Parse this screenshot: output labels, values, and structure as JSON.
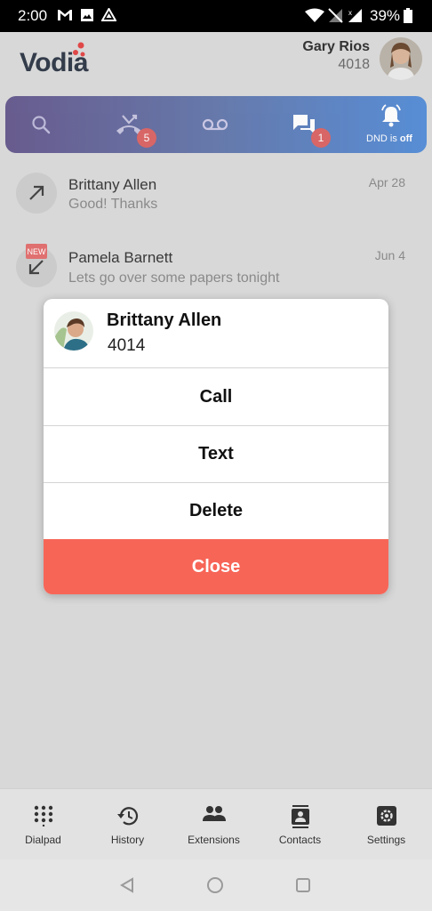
{
  "status_bar": {
    "time": "2:00",
    "battery": "39%",
    "icons": [
      "gmail-icon",
      "image-icon",
      "drive-icon",
      "wifi-icon",
      "signal-off-icon",
      "signal-icon",
      "battery-icon"
    ]
  },
  "header": {
    "logo": "Vodia",
    "user_name": "Gary Rios",
    "user_ext": "4018"
  },
  "top_nav": {
    "items": [
      {
        "name": "search",
        "icon": "search-icon"
      },
      {
        "name": "missed-calls",
        "icon": "missed-call-icon",
        "badge": "5"
      },
      {
        "name": "voicemail",
        "icon": "voicemail-icon"
      },
      {
        "name": "messages",
        "icon": "chat-icon",
        "badge": "1"
      },
      {
        "name": "dnd",
        "icon": "bell-icon",
        "label_prefix": "DND is ",
        "label_state": "off"
      }
    ]
  },
  "list": [
    {
      "name": "Brittany Allen",
      "message": "Good! Thanks",
      "date": "Apr 28",
      "direction": "outgoing"
    },
    {
      "name": "Pamela Barnett",
      "message": "Lets go over some papers tonight",
      "date": "Jun 4",
      "direction": "incoming",
      "tag": "NEW"
    }
  ],
  "dialog": {
    "name": "Brittany Allen",
    "ext": "4014",
    "buttons": {
      "call": "Call",
      "text": "Text",
      "delete": "Delete",
      "close": "Close"
    }
  },
  "bottom_nav": [
    {
      "label": "Dialpad",
      "icon": "dialpad-icon"
    },
    {
      "label": "History",
      "icon": "history-icon"
    },
    {
      "label": "Extensions",
      "icon": "extensions-icon"
    },
    {
      "label": "Contacts",
      "icon": "contacts-icon"
    },
    {
      "label": "Settings",
      "icon": "settings-icon"
    }
  ],
  "colors": {
    "accent_close": "#f76557",
    "badge": "#d95a5a",
    "logo_dots": "#e04848"
  }
}
